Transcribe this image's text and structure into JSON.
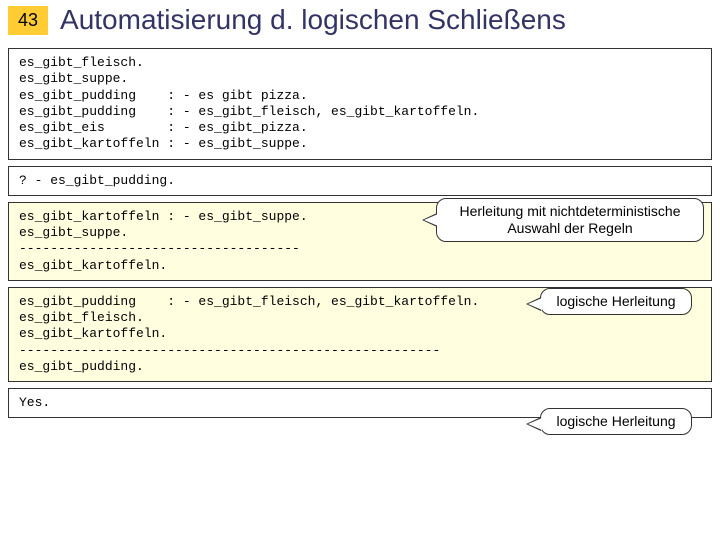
{
  "page_number": "43",
  "title": "Automatisierung d. logischen Schließens",
  "box1": "es_gibt_fleisch.\nes_gibt_suppe.\nes_gibt_pudding    : - es gibt pizza.\nes_gibt_pudding    : - es_gibt_fleisch, es_gibt_kartoffeln.\nes_gibt_eis        : - es_gibt_pizza.\nes_gibt_kartoffeln : - es_gibt_suppe.",
  "box2": "? - es_gibt_pudding.",
  "box3": "es_gibt_kartoffeln : - es_gibt_suppe.\nes_gibt_suppe.\n------------------------------------\nes_gibt_kartoffeln.",
  "box4": "es_gibt_pudding    : - es_gibt_fleisch, es_gibt_kartoffeln.\nes_gibt_fleisch.\nes_gibt_kartoffeln.\n------------------------------------------------------\nes_gibt_pudding.",
  "box5": "Yes.",
  "callout_herleitung_line1": "Herleitung mit nichtdeterministische",
  "callout_herleitung_line2": "Auswahl der Regeln",
  "callout_log": "logische Herleitung"
}
